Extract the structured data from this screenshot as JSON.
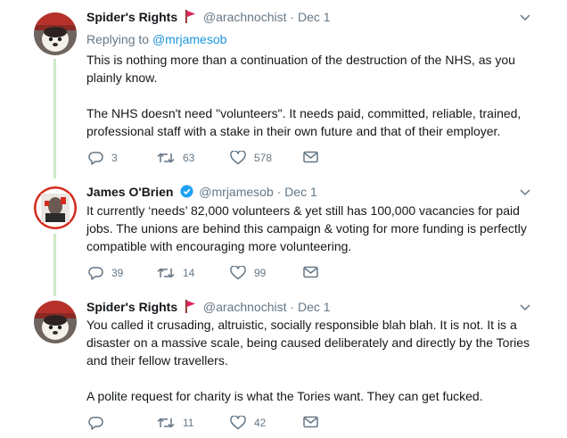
{
  "tweets": [
    {
      "name": "Spider's Rights",
      "handle": "@arachnochist",
      "separator": "·",
      "date": "Dec 1",
      "reply_prefix": "Replying to",
      "reply_to": "@mrjamesob",
      "paragraphs": [
        "This is nothing more than a continuation of the destruction of the NHS, as you plainly know.",
        "The NHS doesn't need \"volunteers\". It needs paid, committed, reliable, trained, professional staff with a stake in their own future and that of their employer."
      ],
      "replies": "3",
      "retweets": "63",
      "likes": "578"
    },
    {
      "name": "James O'Brien",
      "handle": "@mrjamesob",
      "separator": "·",
      "date": "Dec 1",
      "paragraphs": [
        "It currently ‘needs’ 82,000 volunteers & yet still has 100,000 vacancies for paid jobs. The unions are behind this campaign & voting for more funding is perfectly compatible with encouraging more volunteering."
      ],
      "replies": "39",
      "retweets": "14",
      "likes": "99"
    },
    {
      "name": "Spider's Rights",
      "handle": "@arachnochist",
      "separator": "·",
      "date": "Dec 1",
      "paragraphs": [
        "You called it crusading, altruistic, socially responsible blah blah. It is not. It is a disaster on a massive scale, being caused deliberately and directly by the Tories and their fellow travellers.",
        "A polite request for charity is what the Tories want. They can get fucked."
      ],
      "replies": "",
      "retweets": "11",
      "likes": "42"
    }
  ],
  "colors": {
    "text": "#14171a",
    "muted": "#657786",
    "link": "#1b95e0",
    "thread_line": "#cde8c6",
    "flag": "#e0245e",
    "verified": "#1da1f2"
  }
}
